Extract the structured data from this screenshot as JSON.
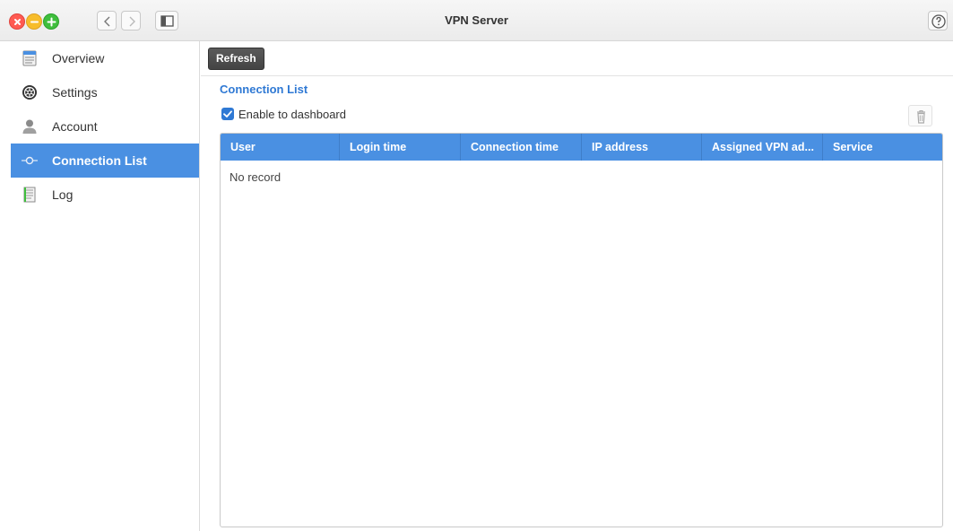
{
  "window": {
    "title": "VPN Server",
    "controls": [
      "close-icon",
      "minimize-icon",
      "maximize-icon"
    ],
    "nav_icons": [
      "chevron-left-icon",
      "chevron-right-icon",
      "sidebar-panel-icon"
    ],
    "help_icon": "help-circle-icon"
  },
  "sidebar": {
    "items": [
      {
        "label": "Overview",
        "icon": "overview-icon"
      },
      {
        "label": "Settings",
        "icon": "settings-icon"
      },
      {
        "label": "Account",
        "icon": "user-icon"
      },
      {
        "label": "Connection List",
        "icon": "connection-icon",
        "active": true
      },
      {
        "label": "Log",
        "icon": "log-icon"
      }
    ]
  },
  "toolbar": {
    "refresh_label": "Refresh"
  },
  "main": {
    "section_title": "Connection List",
    "enable_dashboard_label": "Enable to dashboard",
    "enable_dashboard_checked": true,
    "delete_icon": "trash-icon",
    "table": {
      "columns": [
        "User",
        "Login time",
        "Connection time",
        "IP address",
        "Assigned VPN ad...",
        "Service"
      ],
      "rows": [],
      "empty_message": "No record"
    }
  },
  "colors": {
    "accent": "#4a90e2",
    "title_blue": "#2f79d4",
    "close": "#ff5a52",
    "minimize": "#f7bd2b",
    "maximize": "#3fbe3d"
  }
}
